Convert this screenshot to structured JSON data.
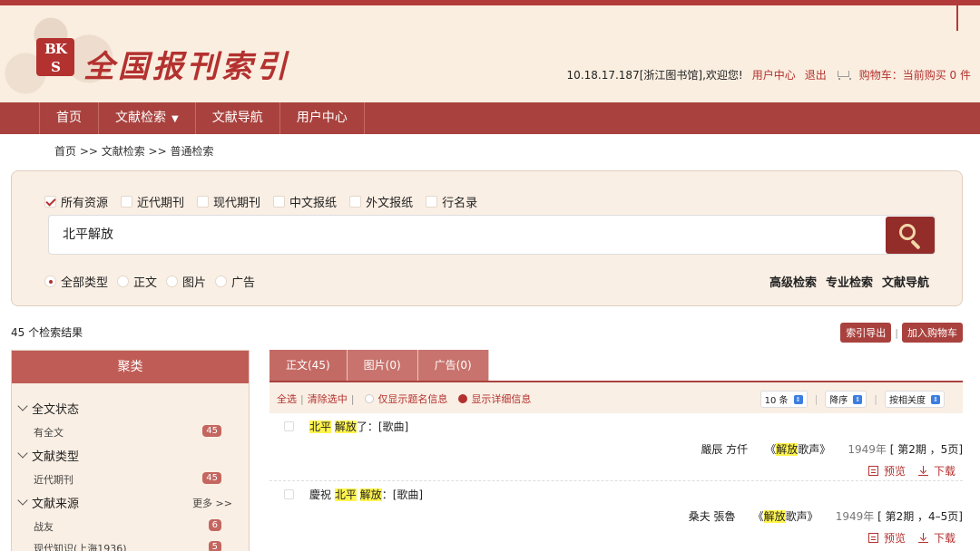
{
  "brand": {
    "logo_text_top": "BK",
    "logo_text_bottom": "S",
    "title": "全国报刊索引"
  },
  "userbar": {
    "greeting": "10.18.17.187[浙江图书馆],欢迎您!",
    "user_center": "用户中心",
    "logout": "退出",
    "cart": "购物车：当前购买 0 件"
  },
  "nav": {
    "items": [
      "首页",
      "文献检索",
      "文献导航",
      "用户中心"
    ]
  },
  "breadcrumb": "首页 >> 文献检索 >> 普通检索",
  "filters": [
    {
      "label": "所有资源",
      "checked": true
    },
    {
      "label": "近代期刊",
      "checked": false
    },
    {
      "label": "现代期刊",
      "checked": false
    },
    {
      "label": "中文报纸",
      "checked": false
    },
    {
      "label": "外文报纸",
      "checked": false
    },
    {
      "label": "行名录",
      "checked": false
    }
  ],
  "search": {
    "value": "北平解放"
  },
  "types": [
    {
      "label": "全部类型",
      "checked": true
    },
    {
      "label": "正文",
      "checked": false
    },
    {
      "label": "图片",
      "checked": false
    },
    {
      "label": "广告",
      "checked": false
    }
  ],
  "advanced_links": [
    "高级检索",
    "专业检索",
    "文献导航"
  ],
  "result_count": "45 个检索结果",
  "actions": {
    "export": "索引导出",
    "add_cart": "加入购物车"
  },
  "sidebar": {
    "title": "聚类",
    "groups": [
      {
        "title": "全文状态",
        "items": [
          {
            "label": "有全文",
            "count": "45"
          }
        ]
      },
      {
        "title": "文献类型",
        "items": [
          {
            "label": "近代期刊",
            "count": "45"
          }
        ]
      },
      {
        "title": "文献来源",
        "more": "更多 >>",
        "items": [
          {
            "label": "战友",
            "count": "6"
          },
          {
            "label": "现代知识(上海1936)",
            "count": "5"
          }
        ]
      }
    ]
  },
  "tabs": [
    "正文(45)",
    "图片(0)",
    "广告(0)"
  ],
  "toolbar": {
    "select_all": "全选",
    "clear": "清除选中",
    "title_only": "仅显示题名信息",
    "detail": "显示详细信息",
    "per_page": "10 条",
    "order": "降序",
    "sort": "按相关度"
  },
  "results": [
    {
      "t1": "北平",
      "t2": "解放",
      "t3": "了：[歌曲]",
      "authors": "嚴辰 方仟",
      "src_pre": "《",
      "src_hl": "解放",
      "src_post": "歌声》",
      "year": "1949年",
      "issue": "[ 第2期 ，5页]",
      "preview": "预览",
      "download": "下载"
    },
    {
      "t0": "慶祝 ",
      "t1": "北平",
      "t2": "解放",
      "t3": "：[歌曲]",
      "authors": "桑夫 張魯",
      "src_pre": "《",
      "src_hl": "解放",
      "src_post": "歌声》",
      "year": "1949年",
      "issue": "[ 第2期 ，4–5页]",
      "preview": "预览",
      "download": "下载"
    }
  ]
}
